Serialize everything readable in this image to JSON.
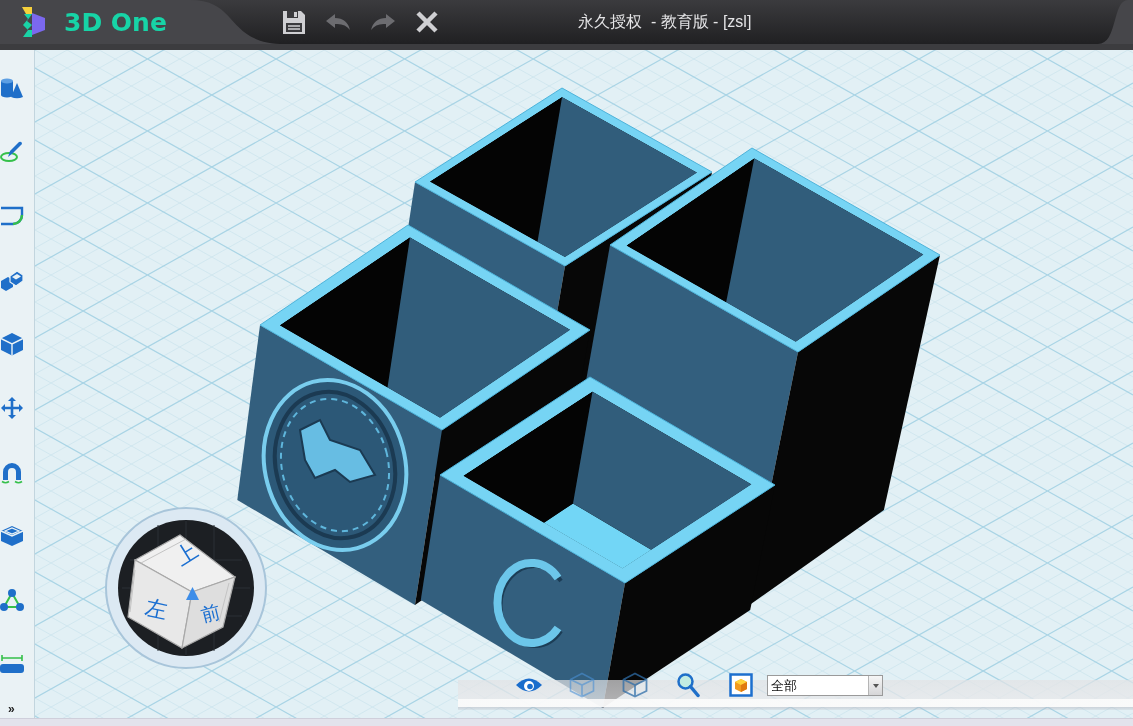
{
  "title_bar": {
    "logo_text": "3D One",
    "quick_actions": [
      {
        "kind": "save",
        "disabled": false
      },
      {
        "kind": "undo",
        "disabled": true
      },
      {
        "kind": "redo",
        "disabled": true
      },
      {
        "kind": "close",
        "disabled": false
      }
    ],
    "title": "永久授权  - 教育版 - [zsl]"
  },
  "left_toolbar": {
    "more_label": "»"
  },
  "view_cube": {
    "top": "上",
    "left": "左",
    "front": "前"
  },
  "bottom_toolbar": {
    "display_filter": {
      "value": "全部"
    }
  }
}
